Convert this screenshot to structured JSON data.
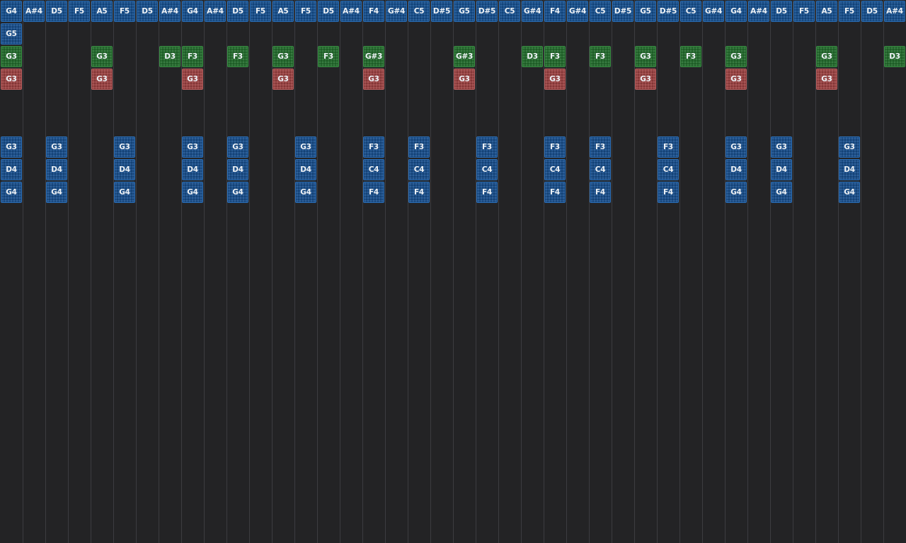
{
  "colors": {
    "background": "#232325",
    "grid_line": "#3c3c40",
    "blue_note": "#1b4f8a",
    "green_note": "#266b2f",
    "red_note": "#9a4444"
  },
  "header_notes": [
    "G4",
    "A#4",
    "D5",
    "F5",
    "A5",
    "F5",
    "D5",
    "A#4",
    "G4",
    "A#4",
    "D5",
    "F5",
    "A5",
    "F5",
    "D5",
    "A#4",
    "F4",
    "G#4",
    "C5",
    "D#5",
    "G5",
    "D#5",
    "C5",
    "G#4",
    "F4",
    "G#4",
    "C5",
    "D#5",
    "G5",
    "D#5",
    "C5",
    "G#4",
    "G4",
    "A#4",
    "D5",
    "F5",
    "A5",
    "F5",
    "D5",
    "A#4"
  ],
  "rows": [
    {
      "row": 1,
      "color": "blue",
      "cells": [
        {
          "col": 0,
          "note": "G5"
        }
      ]
    },
    {
      "row": 2,
      "color": "green",
      "cells": [
        {
          "col": 0,
          "note": "G3"
        },
        {
          "col": 4,
          "note": "G3"
        },
        {
          "col": 7,
          "note": "D3"
        },
        {
          "col": 8,
          "note": "F3"
        },
        {
          "col": 10,
          "note": "F3"
        },
        {
          "col": 12,
          "note": "G3"
        },
        {
          "col": 14,
          "note": "F3"
        },
        {
          "col": 16,
          "note": "G#3"
        },
        {
          "col": 20,
          "note": "G#3"
        },
        {
          "col": 23,
          "note": "D3"
        },
        {
          "col": 24,
          "note": "F3"
        },
        {
          "col": 26,
          "note": "F3"
        },
        {
          "col": 28,
          "note": "G3"
        },
        {
          "col": 30,
          "note": "F3"
        },
        {
          "col": 32,
          "note": "G3"
        },
        {
          "col": 36,
          "note": "G3"
        },
        {
          "col": 39,
          "note": "D3"
        }
      ]
    },
    {
      "row": 3,
      "color": "red",
      "cells": [
        {
          "col": 0,
          "note": "G3"
        },
        {
          "col": 4,
          "note": "G3"
        },
        {
          "col": 8,
          "note": "G3"
        },
        {
          "col": 12,
          "note": "G3"
        },
        {
          "col": 16,
          "note": "G3"
        },
        {
          "col": 20,
          "note": "G3"
        },
        {
          "col": 24,
          "note": "G3"
        },
        {
          "col": 28,
          "note": "G3"
        },
        {
          "col": 32,
          "note": "G3"
        },
        {
          "col": 36,
          "note": "G3"
        }
      ]
    },
    {
      "row": 6,
      "color": "blue",
      "cells": [
        {
          "col": 0,
          "note": "G3"
        },
        {
          "col": 2,
          "note": "G3"
        },
        {
          "col": 5,
          "note": "G3"
        },
        {
          "col": 8,
          "note": "G3"
        },
        {
          "col": 10,
          "note": "G3"
        },
        {
          "col": 13,
          "note": "G3"
        },
        {
          "col": 16,
          "note": "F3"
        },
        {
          "col": 18,
          "note": "F3"
        },
        {
          "col": 21,
          "note": "F3"
        },
        {
          "col": 24,
          "note": "F3"
        },
        {
          "col": 26,
          "note": "F3"
        },
        {
          "col": 29,
          "note": "F3"
        },
        {
          "col": 32,
          "note": "G3"
        },
        {
          "col": 34,
          "note": "G3"
        },
        {
          "col": 37,
          "note": "G3"
        }
      ]
    },
    {
      "row": 7,
      "color": "blue",
      "cells": [
        {
          "col": 0,
          "note": "D4"
        },
        {
          "col": 2,
          "note": "D4"
        },
        {
          "col": 5,
          "note": "D4"
        },
        {
          "col": 8,
          "note": "D4"
        },
        {
          "col": 10,
          "note": "D4"
        },
        {
          "col": 13,
          "note": "D4"
        },
        {
          "col": 16,
          "note": "C4"
        },
        {
          "col": 18,
          "note": "C4"
        },
        {
          "col": 21,
          "note": "C4"
        },
        {
          "col": 24,
          "note": "C4"
        },
        {
          "col": 26,
          "note": "C4"
        },
        {
          "col": 29,
          "note": "C4"
        },
        {
          "col": 32,
          "note": "D4"
        },
        {
          "col": 34,
          "note": "D4"
        },
        {
          "col": 37,
          "note": "D4"
        }
      ]
    },
    {
      "row": 8,
      "color": "blue",
      "cells": [
        {
          "col": 0,
          "note": "G4"
        },
        {
          "col": 2,
          "note": "G4"
        },
        {
          "col": 5,
          "note": "G4"
        },
        {
          "col": 8,
          "note": "G4"
        },
        {
          "col": 10,
          "note": "G4"
        },
        {
          "col": 13,
          "note": "G4"
        },
        {
          "col": 16,
          "note": "F4"
        },
        {
          "col": 18,
          "note": "F4"
        },
        {
          "col": 21,
          "note": "F4"
        },
        {
          "col": 24,
          "note": "F4"
        },
        {
          "col": 26,
          "note": "F4"
        },
        {
          "col": 29,
          "note": "F4"
        },
        {
          "col": 32,
          "note": "G4"
        },
        {
          "col": 34,
          "note": "G4"
        },
        {
          "col": 37,
          "note": "G4"
        }
      ]
    }
  ]
}
